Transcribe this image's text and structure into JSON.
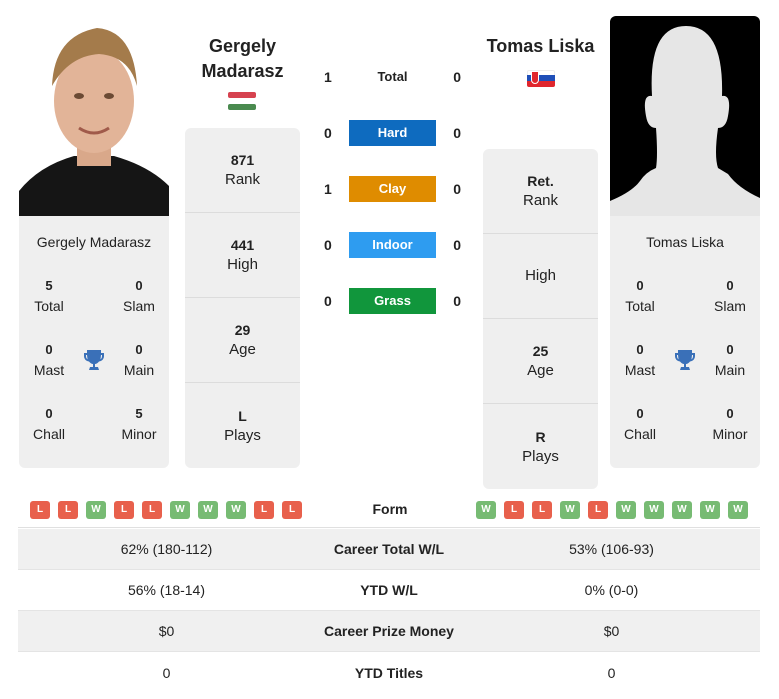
{
  "player1": {
    "name_line1": "Gergely",
    "name_line2": "Madarasz",
    "full_name": "Gergely Madarasz",
    "country": "Hungary",
    "flag_colors": [
      "#d6424f",
      "#ffffff",
      "#4a8a4f"
    ],
    "stats": [
      {
        "value": "871",
        "label": "Rank"
      },
      {
        "value": "441",
        "label": "High"
      },
      {
        "value": "29",
        "label": "Age"
      },
      {
        "value": "L",
        "label": "Plays"
      }
    ],
    "titles": {
      "total": "5",
      "total_label": "Total",
      "slam": "0",
      "slam_label": "Slam",
      "mast": "0",
      "mast_label": "Mast",
      "main": "0",
      "main_label": "Main",
      "chall": "0",
      "chall_label": "Chall",
      "minor": "5",
      "minor_label": "Minor"
    },
    "form": [
      "L",
      "L",
      "W",
      "L",
      "L",
      "W",
      "W",
      "W",
      "L",
      "L"
    ]
  },
  "player2": {
    "name": "Tomas Liska",
    "full_name": "Tomas Liska",
    "country": "Slovakia",
    "stats": [
      {
        "value": "Ret.",
        "label": "Rank"
      },
      {
        "value": "",
        "label": "High"
      },
      {
        "value": "25",
        "label": "Age"
      },
      {
        "value": "R",
        "label": "Plays"
      }
    ],
    "titles": {
      "total": "0",
      "total_label": "Total",
      "slam": "0",
      "slam_label": "Slam",
      "mast": "0",
      "mast_label": "Mast",
      "main": "0",
      "main_label": "Main",
      "chall": "0",
      "chall_label": "Chall",
      "minor": "0",
      "minor_label": "Minor"
    },
    "form": [
      "W",
      "L",
      "L",
      "W",
      "L",
      "W",
      "W",
      "W",
      "W",
      "W"
    ]
  },
  "h2h": {
    "total": {
      "label": "Total",
      "p1": "1",
      "p2": "0"
    },
    "surfaces": [
      {
        "label": "Hard",
        "p1": "0",
        "p2": "0",
        "color": "#0e6bbf"
      },
      {
        "label": "Clay",
        "p1": "1",
        "p2": "0",
        "color": "#df8c00"
      },
      {
        "label": "Indoor",
        "p1": "0",
        "p2": "0",
        "color": "#2e9cf0"
      },
      {
        "label": "Grass",
        "p1": "0",
        "p2": "0",
        "color": "#11963c"
      }
    ]
  },
  "form_label": "Form",
  "comparison": [
    {
      "label": "Career Total W/L",
      "p1": "62% (180-112)",
      "p2": "53% (106-93)"
    },
    {
      "label": "YTD W/L",
      "p1": "56% (18-14)",
      "p2": "0% (0-0)"
    },
    {
      "label": "Career Prize Money",
      "p1": "$0",
      "p2": "$0"
    },
    {
      "label": "YTD Titles",
      "p1": "0",
      "p2": "0"
    }
  ],
  "icons": {
    "trophy": "trophy-icon"
  }
}
